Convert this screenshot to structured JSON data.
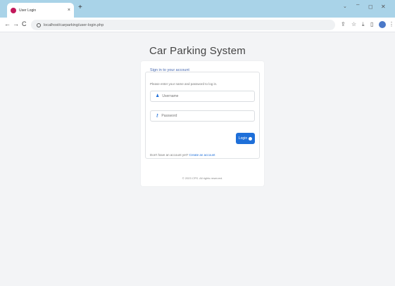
{
  "browser": {
    "tab_title": "User Login",
    "tab_close": "×",
    "new_tab": "+",
    "url": "localhost/carparking/user-login.php",
    "window_controls": {
      "minimize": "–",
      "maximize": "◻",
      "close": "✕",
      "tab_search": "⌄"
    },
    "nav": {
      "back": "←",
      "forward": "→",
      "reload": "C"
    },
    "toolbar_icons": [
      "share-icon",
      "star-icon",
      "download-icon",
      "side-panel-icon",
      "profile-icon",
      "menu-icon"
    ]
  },
  "page": {
    "title": "Car Parking System"
  },
  "login": {
    "legend": "Sign in to your account",
    "instructions": "Please enter your name and password to log in.",
    "username_placeholder": "Username",
    "password_placeholder": "Password",
    "login_button": "Login",
    "signup_prompt": "Don't have an account yet?",
    "signup_link": "Create an account"
  },
  "footer": {
    "text": "© 2023 CPS. All rights reserved."
  },
  "colors": {
    "accent": "#1e6fd9",
    "tabbar": "#a9d3e8",
    "page_bg": "#f3f4f6",
    "legend": "#4668b0"
  }
}
